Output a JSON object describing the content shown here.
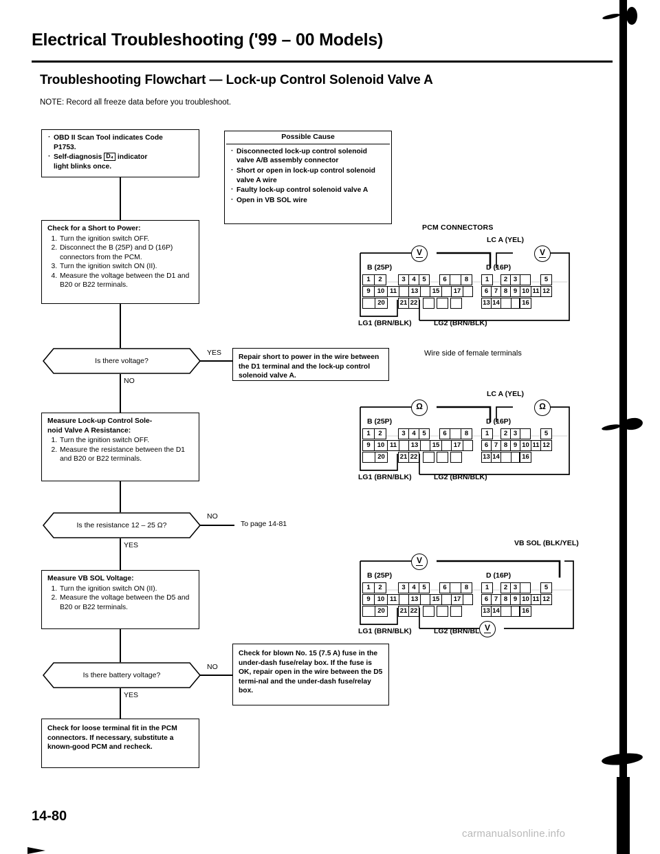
{
  "header": {
    "title": "Electrical Troubleshooting ('99 – 00 Models)",
    "section_title": "Troubleshooting Flowchart — Lock-up Control Solenoid Valve A",
    "note": "NOTE:  Record all freeze data before you troubleshoot."
  },
  "flow": {
    "start_box": {
      "items": [
        "OBD II Scan Tool indicates Code P1753.",
        "Self-diagnosis D₄ indicator light blinks once."
      ],
      "line1a": "OBD II Scan Tool indicates Code",
      "line1b": "P1753.",
      "line2a": "Self-diagnosis",
      "line2icon": "D₄",
      "line2b": "indicator",
      "line3": "light blinks once."
    },
    "possible_cause": {
      "title": "Possible Cause",
      "items": [
        "Disconnected lock-up control solenoid valve A/B assembly connector",
        "Short or open in lock-up control solenoid valve A wire",
        "Faulty lock-up control solenoid valve A",
        "Open in VB SOL wire"
      ]
    },
    "short_to_power": {
      "heading": "Check for a Short to Power:",
      "steps": [
        "Turn the ignition switch OFF.",
        "Disconnect the B (25P) and D (16P) connectors from the PCM.",
        "Turn the ignition switch ON (II).",
        "Measure the voltage between the D1 and B20 or B22 terminals."
      ]
    },
    "q_voltage": {
      "text": "Is there voltage?",
      "yes": "YES",
      "no": "NO"
    },
    "repair_short": {
      "text": "Repair short to power in the wire between the D1 terminal and the lock-up control solenoid valve A."
    },
    "measure_resistance": {
      "heading": "Measure Lock-up Control Sole-noid Valve A Resistance:",
      "heading_line1": "Measure Lock-up Control Sole-",
      "heading_line2": "noid Valve A Resistance:",
      "steps": [
        "Turn the ignition switch OFF.",
        "Measure the resistance between the D1 and B20 or B22 terminals."
      ]
    },
    "q_resistance": {
      "text": "Is the resistance 12 – 25 Ω?",
      "yes": "YES",
      "no": "NO"
    },
    "to_page": "To page 14-81",
    "measure_vb_sol": {
      "heading": "Measure VB SOL Voltage:",
      "steps": [
        "Turn the ignition switch ON (II).",
        "Measure the voltage between the D5 and B20 or B22 terminals."
      ]
    },
    "q_battery": {
      "text": "Is there battery voltage?",
      "yes": "YES",
      "no": "NO"
    },
    "check_fuse": {
      "text": "Check for blown No. 15 (7.5 A) fuse in the under-dash fuse/relay box. If the fuse is OK, repair open in the wire between the D5 termi-nal and the under-dash fuse/relay box."
    },
    "check_terminal_fit": {
      "text": "Check for loose terminal fit in the PCM connectors. If necessary, substitute a known-good PCM and recheck."
    }
  },
  "diagrams": {
    "pcm_connectors_label": "PCM CONNECTORS",
    "wire_side_label": "Wire side of female terminals",
    "connector_b_label": "B (25P)",
    "connector_d_label": "D (16P)",
    "lg1_label": "LG1 (BRN/BLK)",
    "lg2_label": "LG2 (BRN/BLK)",
    "lc_a_label": "LC A (YEL)",
    "vb_sol_label": "VB SOL (BLK/YEL)",
    "meter_volt": "V",
    "meter_ohm": "Ω",
    "b_connector_rows": [
      [
        "1",
        "2",
        "",
        "3",
        "4",
        "5",
        "",
        "6",
        "",
        "8"
      ],
      [
        "9",
        "10",
        "11",
        "",
        "13",
        "",
        "15",
        "",
        "17",
        ""
      ],
      [
        "",
        "20",
        "",
        "21",
        "22",
        "",
        "",
        "",
        "",
        ""
      ]
    ],
    "d_connector_rows": [
      [
        "1",
        "",
        "2",
        "3",
        "",
        "",
        "5"
      ],
      [
        "6",
        "7",
        "8",
        "9",
        "10",
        "11",
        "12"
      ],
      [
        "13",
        "14",
        "",
        "",
        "16",
        "",
        ""
      ]
    ],
    "diagram1_meters": [
      "V",
      "V"
    ],
    "diagram2_meters": [
      "Ω",
      "Ω"
    ],
    "diagram3_meters": [
      "V",
      "V"
    ]
  },
  "footer": {
    "page_number": "14-80",
    "watermark": "carmanualsonline.info"
  }
}
